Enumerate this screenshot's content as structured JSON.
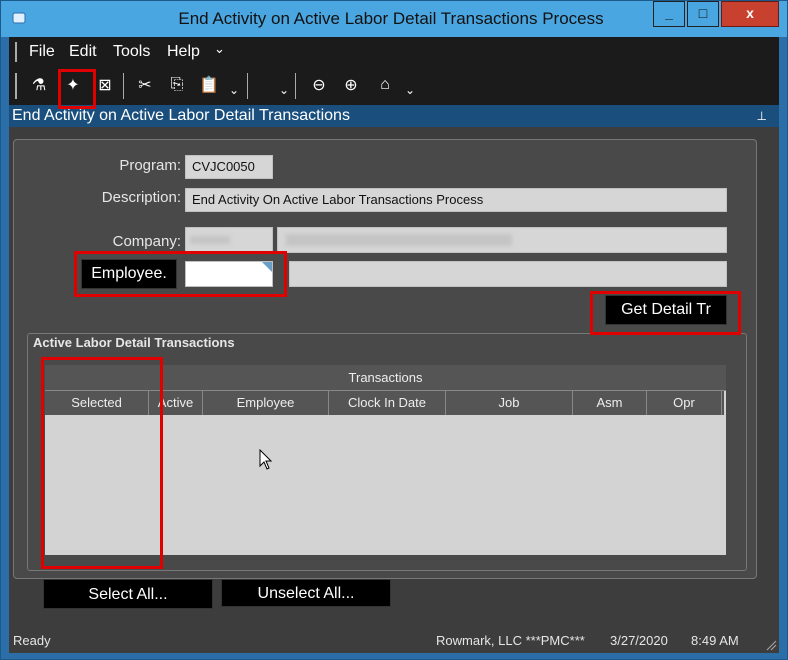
{
  "window": {
    "title": "End Activity on Active Labor Detail Transactions Process",
    "minimize_glyph": "_",
    "maximize_glyph": "□",
    "close_glyph": "x"
  },
  "menu": {
    "items": [
      "File",
      "Edit",
      "Tools",
      "Help"
    ],
    "overflow": "⌄"
  },
  "toolbar": {
    "icons": [
      "clear-icon",
      "new-icon",
      "save-icon",
      "cut-icon",
      "copy-icon",
      "paste-icon",
      "back-icon",
      "forward-icon",
      "home-icon"
    ],
    "glyphs": [
      "⚗",
      "✦",
      "⊠",
      "✂",
      "⎘",
      "📋",
      "⊖",
      "⊕",
      "⌂"
    ]
  },
  "panel": {
    "title": "End Activity on Active Labor Detail Transactions",
    "pin_glyph": "⊥"
  },
  "form": {
    "program_label": "Program:",
    "program_value": "CVJC0050",
    "description_label": "Description:",
    "description_value": "End Activity On Active Labor Transactions Process",
    "company_label": "Company:",
    "employee_button": "Employee.",
    "get_detail_button": "Get Detail Tr"
  },
  "group": {
    "title": "Active Labor Detail Transactions",
    "band": "Transactions",
    "columns": [
      "Selected",
      "Active",
      "Employee",
      "Clock In Date",
      "Job",
      "Asm",
      "Opr"
    ]
  },
  "buttons": {
    "select_all": "Select All...",
    "unselect_all": "Unselect All..."
  },
  "status": {
    "left": "Ready",
    "company": "Rowmark, LLC ***PMC***",
    "date": "3/27/2020",
    "time": "8:49 AM"
  }
}
